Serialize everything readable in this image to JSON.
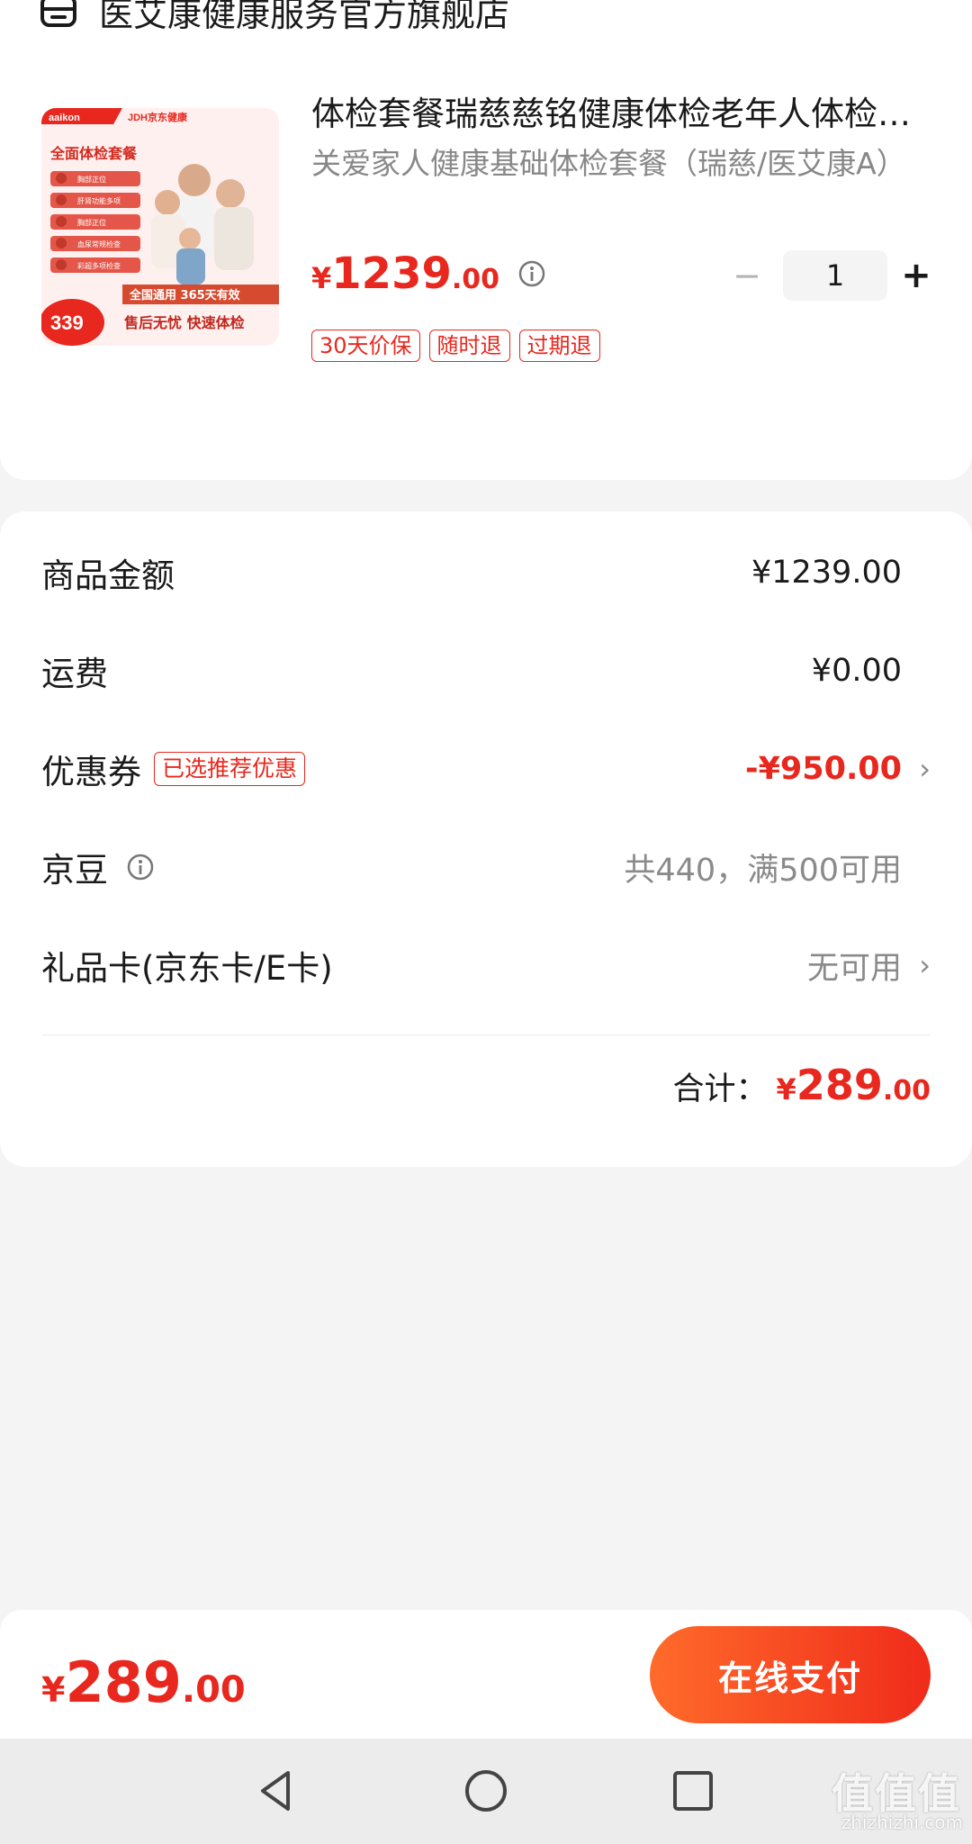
{
  "store": {
    "name": "医艾康健康服务官方旗舰店",
    "icon": "store-icon"
  },
  "product": {
    "title": "体检套餐瑞慈慈铭健康体检老年人体检套餐",
    "subtitle": "关爱家人健康基础体检套餐（瑞慈/医艾康A）",
    "price_yen": "¥",
    "price_int": "1239",
    "price_dec": ".00",
    "quantity": "1",
    "minus_label": "−",
    "plus_label": "+",
    "tags": [
      "30天价保",
      "随时退",
      "过期退"
    ],
    "image": {
      "brand_left": "aaikon",
      "brand_right": "JDH京东健康",
      "heading": "全面体检套餐",
      "checklist": [
        "胸部正位",
        "肝肾功能多项",
        "胸部正位",
        "血尿常规检查",
        "彩超多项检查"
      ],
      "promo": "全国通用 365天有效",
      "badge_price": "339",
      "footer": "售后无忧 快速体检"
    }
  },
  "summary": {
    "goods_label": "商品金额",
    "goods_value": "¥1239.00",
    "shipping_label": "运费",
    "shipping_value": "¥0.00",
    "coupon_label": "优惠券",
    "coupon_tag": "已选推荐优惠",
    "coupon_value": "-¥950.00",
    "beans_label": "京豆",
    "beans_value": "共440，满500可用",
    "giftcard_label": "礼品卡(京东卡/E卡)",
    "giftcard_value": "无可用",
    "total_label": "合计：",
    "total_yen": "¥",
    "total_int": "289",
    "total_dec": ".00"
  },
  "bottom": {
    "yen": "¥",
    "int": "289",
    "dec": ".00",
    "pay_label": "在线支付"
  },
  "watermark": {
    "text": "值值值",
    "sub": "zhizhizhi.com"
  },
  "colors": {
    "accent": "#e8281e",
    "button_start": "#ff6b2a",
    "button_end": "#f02b1b"
  }
}
